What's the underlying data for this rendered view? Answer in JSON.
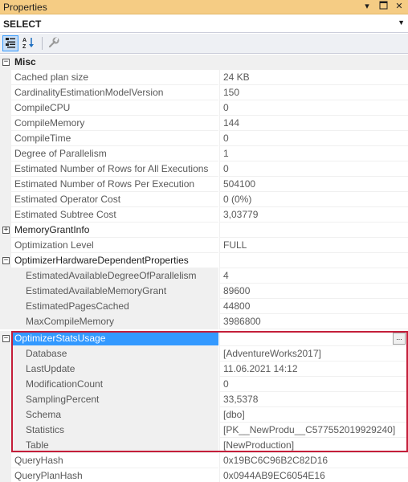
{
  "panel": {
    "title": "Properties",
    "pin_icon": "dropdown-arrow-icon",
    "dock_icon": "pin-icon",
    "close_icon": "close-icon"
  },
  "object_selector": {
    "value": "SELECT"
  },
  "toolbar": {
    "categorized_icon": "categorized-icon",
    "alphabetical_icon": "alphabetical-icon",
    "property_pages_icon": "wrench-icon"
  },
  "misc_category": "Misc",
  "props": {
    "cached_plan_size": {
      "name": "Cached plan size",
      "value": "24 KB"
    },
    "ce_model_version": {
      "name": "CardinalityEstimationModelVersion",
      "value": "150"
    },
    "compile_cpu": {
      "name": "CompileCPU",
      "value": "0"
    },
    "compile_memory": {
      "name": "CompileMemory",
      "value": "144"
    },
    "compile_time": {
      "name": "CompileTime",
      "value": "0"
    },
    "dop": {
      "name": "Degree of Parallelism",
      "value": "1"
    },
    "est_rows_all": {
      "name": "Estimated Number of Rows for All Executions",
      "value": "0"
    },
    "est_rows_per_exec": {
      "name": "Estimated Number of Rows Per Execution",
      "value": "504100"
    },
    "est_operator_cost": {
      "name": "Estimated Operator Cost",
      "value": "0 (0%)"
    },
    "est_subtree_cost": {
      "name": "Estimated Subtree Cost",
      "value": "3,03779"
    },
    "memory_grant_info": {
      "name": "MemoryGrantInfo",
      "value": ""
    },
    "optimization_level": {
      "name": "Optimization Level",
      "value": "FULL"
    },
    "ohdp": {
      "name": "OptimizerHardwareDependentProperties",
      "value": ""
    },
    "ohdp_dop": {
      "name": "EstimatedAvailableDegreeOfParallelism",
      "value": "4"
    },
    "ohdp_mem": {
      "name": "EstimatedAvailableMemoryGrant",
      "value": "89600"
    },
    "ohdp_pages": {
      "name": "EstimatedPagesCached",
      "value": "44800"
    },
    "ohdp_max_mem": {
      "name": "MaxCompileMemory",
      "value": "3986800"
    },
    "osu": {
      "name": "OptimizerStatsUsage",
      "value": ""
    },
    "osu_database": {
      "name": "Database",
      "value": "[AdventureWorks2017]"
    },
    "osu_last_update": {
      "name": "LastUpdate",
      "value": "11.06.2021 14:12"
    },
    "osu_mod_count": {
      "name": "ModificationCount",
      "value": "0"
    },
    "osu_sampling": {
      "name": "SamplingPercent",
      "value": "33,5378"
    },
    "osu_schema": {
      "name": "Schema",
      "value": "[dbo]"
    },
    "osu_statistics": {
      "name": "Statistics",
      "value": "[PK__NewProdu__C577552019929240]"
    },
    "osu_table": {
      "name": "Table",
      "value": "[NewProduction]"
    },
    "query_hash": {
      "name": "QueryHash",
      "value": "0x19BC6C96B2C82D16"
    },
    "query_plan_hash": {
      "name": "QueryPlanHash",
      "value": "0x0944AB9EC6054E16"
    }
  },
  "ellipsis_label": "...",
  "expander_collapsed": "+",
  "expander_expanded": "−"
}
